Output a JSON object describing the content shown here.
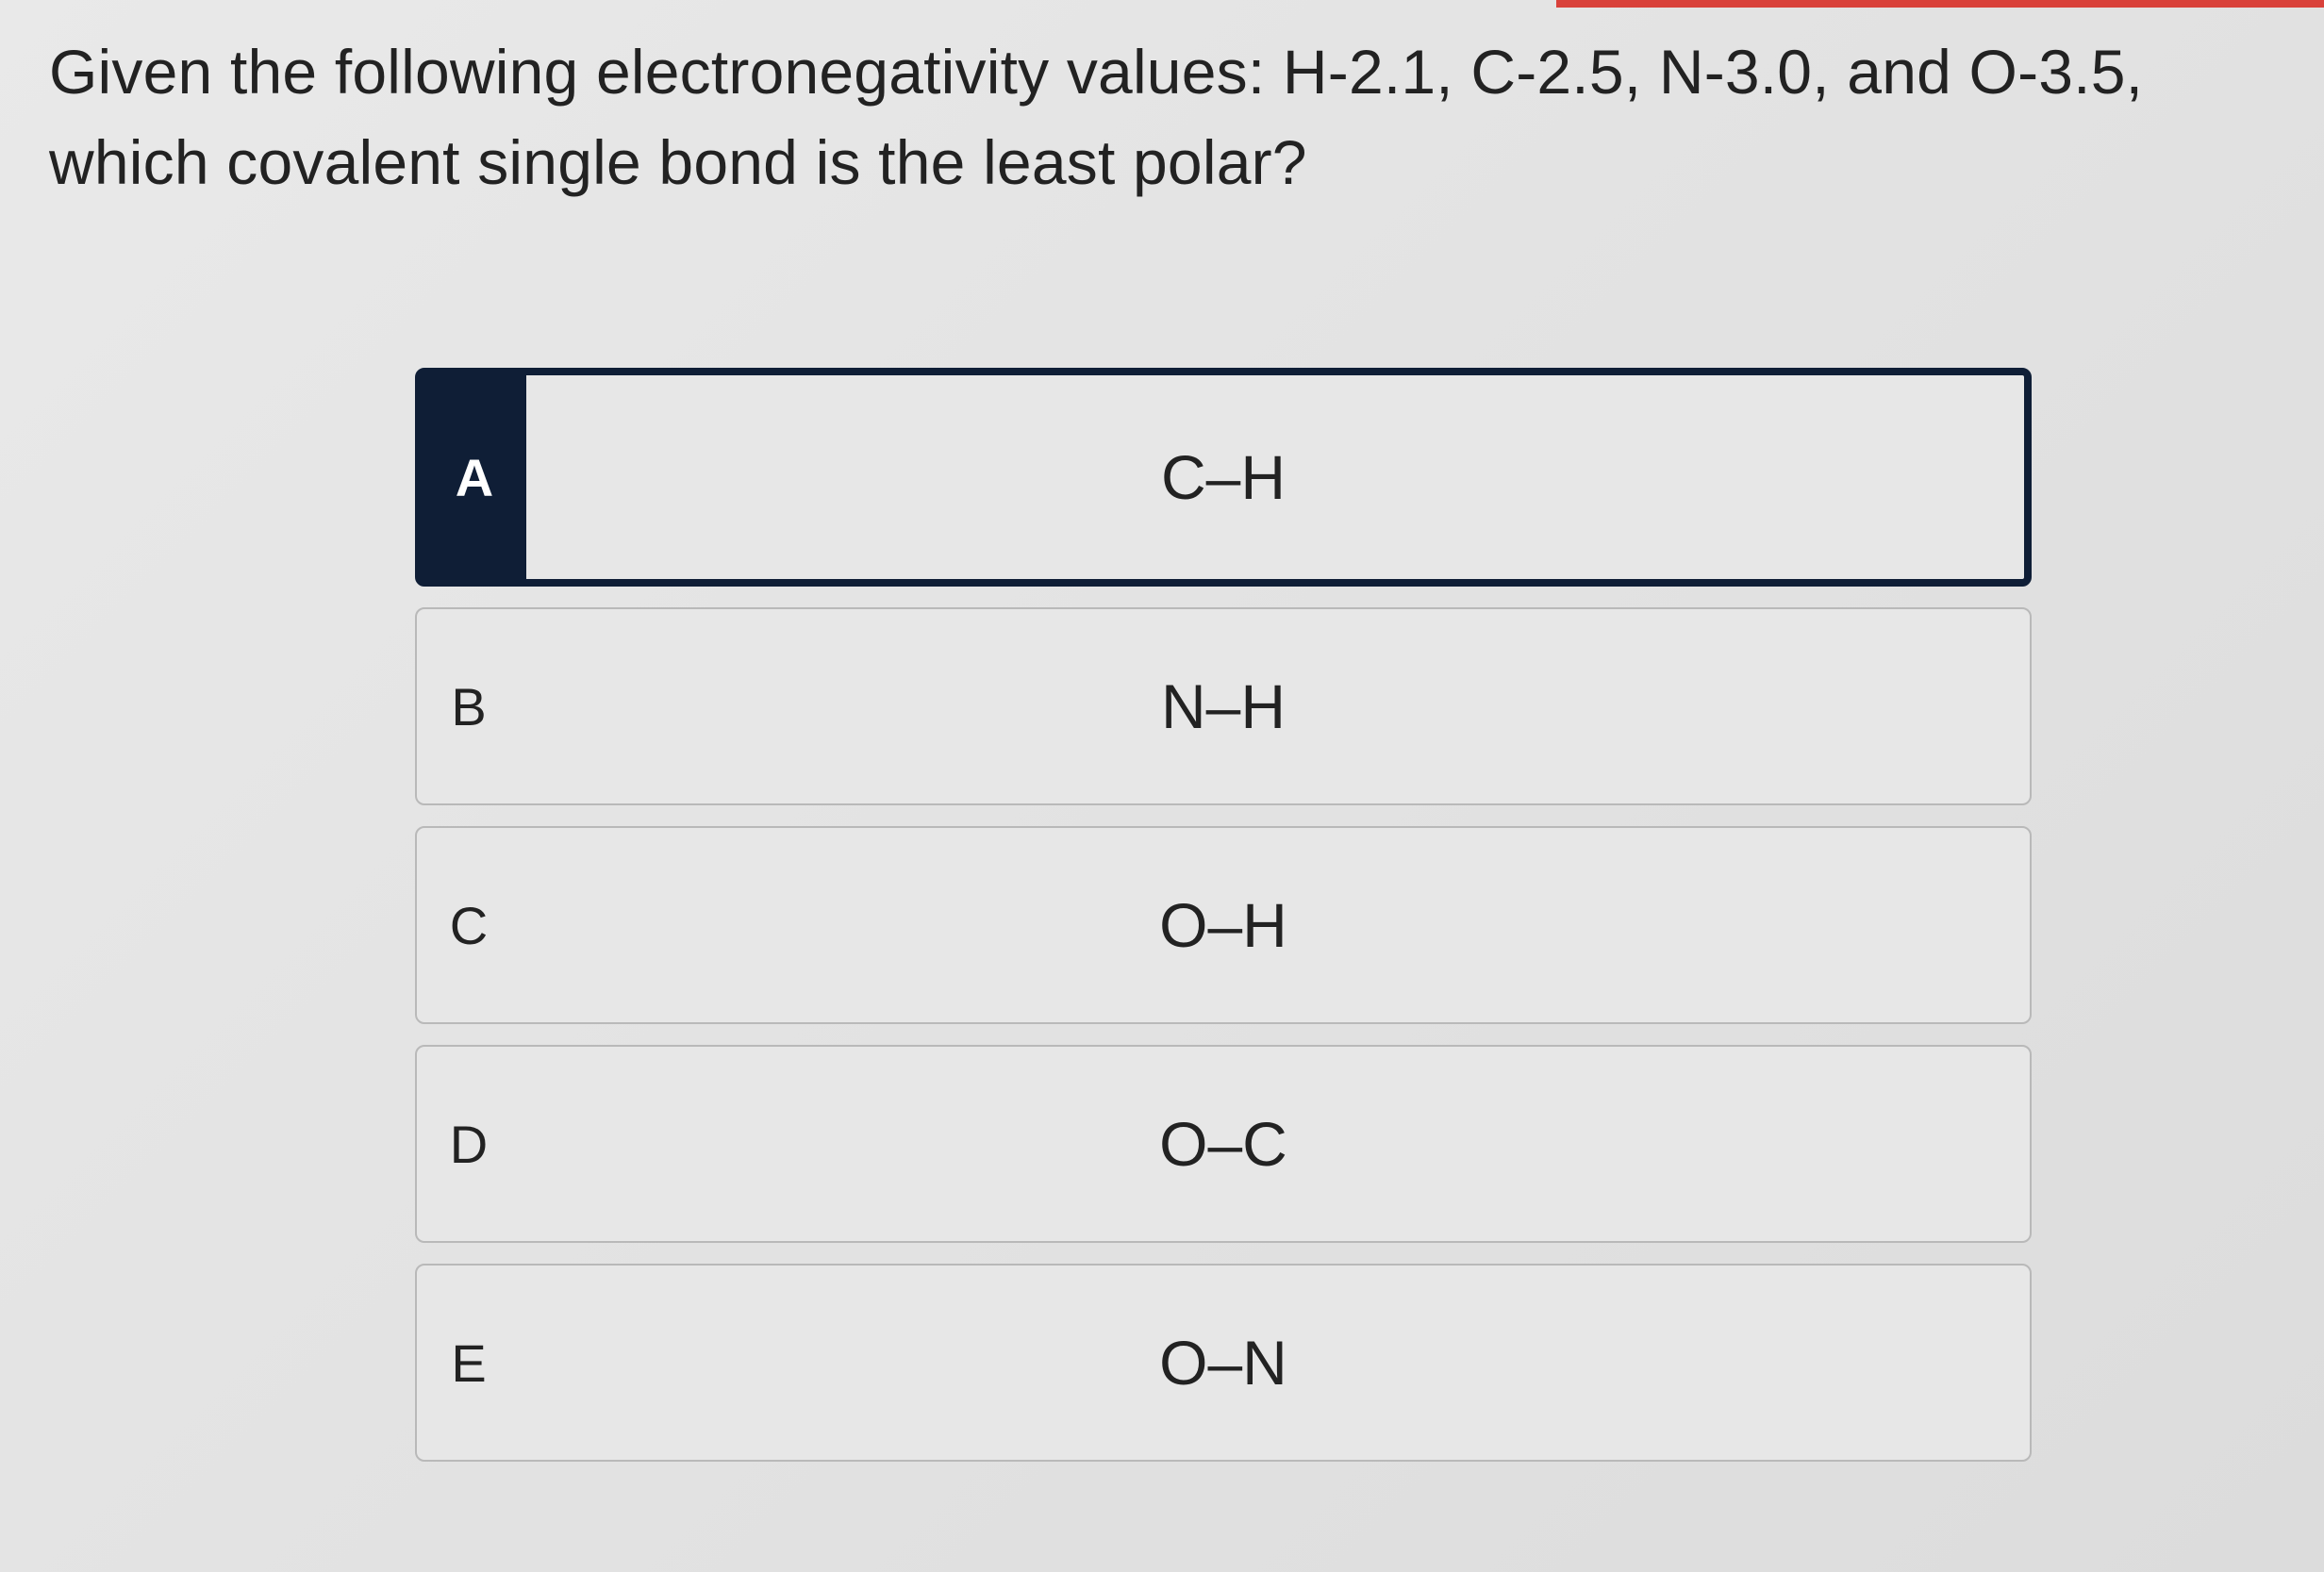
{
  "question": {
    "text": "Given the following electronegativity values:  H-2.1, C-2.5, N-3.0, and O-3.5, which covalent single bond is the least polar?"
  },
  "choices": [
    {
      "letter": "A",
      "label": "C–H",
      "selected": true
    },
    {
      "letter": "B",
      "label": "N–H",
      "selected": false
    },
    {
      "letter": "C",
      "label": "O–H",
      "selected": false
    },
    {
      "letter": "D",
      "label": "O–C",
      "selected": false
    },
    {
      "letter": "E",
      "label": "O–N",
      "selected": false
    }
  ],
  "colors": {
    "selected_accent": "#0f1e36",
    "top_strip": "#d9413a"
  }
}
